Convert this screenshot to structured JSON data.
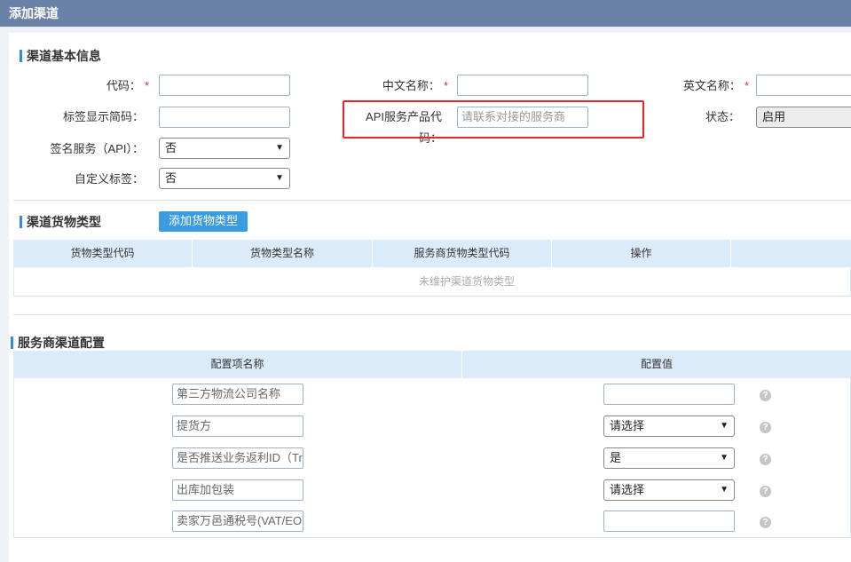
{
  "window": {
    "title": "添加渠道"
  },
  "basic": {
    "section_title": "渠道基本信息",
    "code_label": "代码：",
    "cn_name_label": "中文名称：",
    "en_name_label": "英文名称：",
    "required_mark": "*",
    "tag_short_label": "标签显示简码：",
    "api_code_label": "API服务产品代码：",
    "api_code_placeholder": "请联系对接的服务商",
    "status_label": "状态：",
    "status_value": "启用",
    "sign_label": "签名服务（API）：",
    "sign_value": "否",
    "custom_label_label": "自定义标签：",
    "custom_label_value": "否"
  },
  "cargo": {
    "section_title": "渠道货物类型",
    "add_button": "添加货物类型",
    "columns": [
      "货物类型代码",
      "货物类型名称",
      "服务商货物类型代码",
      "操作",
      ""
    ],
    "empty_text": "未维护渠道货物类型"
  },
  "config": {
    "section_title": "服务商渠道配置",
    "col_name": "配置项名称",
    "col_value": "配置值",
    "rows": [
      {
        "name": "第三方物流公司名称",
        "type": "input",
        "value": ""
      },
      {
        "name": "提货方",
        "type": "select",
        "value": "请选择"
      },
      {
        "name": "是否推送业务返利ID（Trar",
        "type": "select",
        "value": "是"
      },
      {
        "name": "出库加包装",
        "type": "select",
        "value": "请选择"
      },
      {
        "name": "卖家万邑通税号(VAT/EOR",
        "type": "input",
        "value": ""
      }
    ],
    "help_glyph": "?"
  },
  "icons": {
    "dropdown": "chevron-down-icon",
    "help": "question-circle-icon"
  },
  "colors": {
    "titlebar": "#6a82a8",
    "accent": "#3a9be0",
    "table_header": "#dcebf9",
    "highlight": "#e8232b",
    "required": "#d9302c"
  }
}
